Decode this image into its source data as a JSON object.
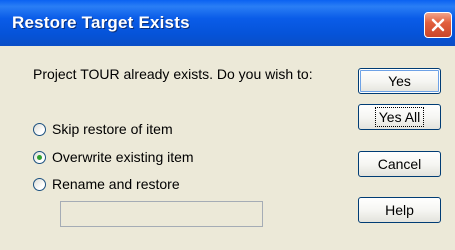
{
  "dialog": {
    "title": "Restore Target Exists",
    "message": "Project TOUR already exists.  Do you wish to:"
  },
  "options": [
    {
      "label": "Skip restore of item",
      "selected": false
    },
    {
      "label": "Overwrite existing item",
      "selected": true
    },
    {
      "label": "Rename and restore",
      "selected": false
    }
  ],
  "rename_field": {
    "value": ""
  },
  "buttons": {
    "yes": "Yes",
    "yes_all": "Yes All",
    "cancel": "Cancel",
    "help": "Help"
  },
  "icons": {
    "close": "close-icon"
  },
  "colors": {
    "title_bar": "#0a5ce8",
    "close_button": "#e2603e",
    "dialog_background": "#ece9d8",
    "selected_radio_dot": "#2e9e2e"
  }
}
